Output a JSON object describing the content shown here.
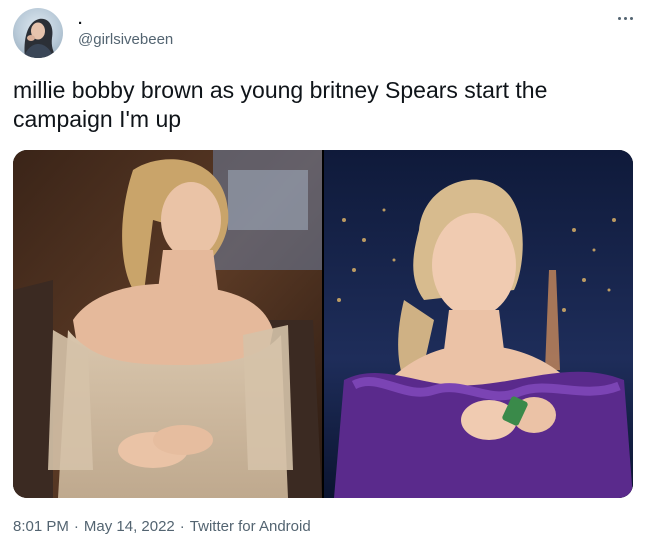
{
  "tweet": {
    "display_name": ".",
    "handle": "@girlsivebeen",
    "text": "millie bobby brown as young britney Spears start the campaign I'm up",
    "media": [
      {
        "label": "photo-left"
      },
      {
        "label": "photo-right"
      }
    ],
    "time": "8:01 PM",
    "separator": "·",
    "date": "May 14, 2022",
    "source": "Twitter for Android"
  },
  "icons": {
    "avatar": "user-avatar",
    "more": "more-horizontal-icon"
  },
  "colors": {
    "text_primary": "#0f1419",
    "text_secondary": "#536471"
  }
}
